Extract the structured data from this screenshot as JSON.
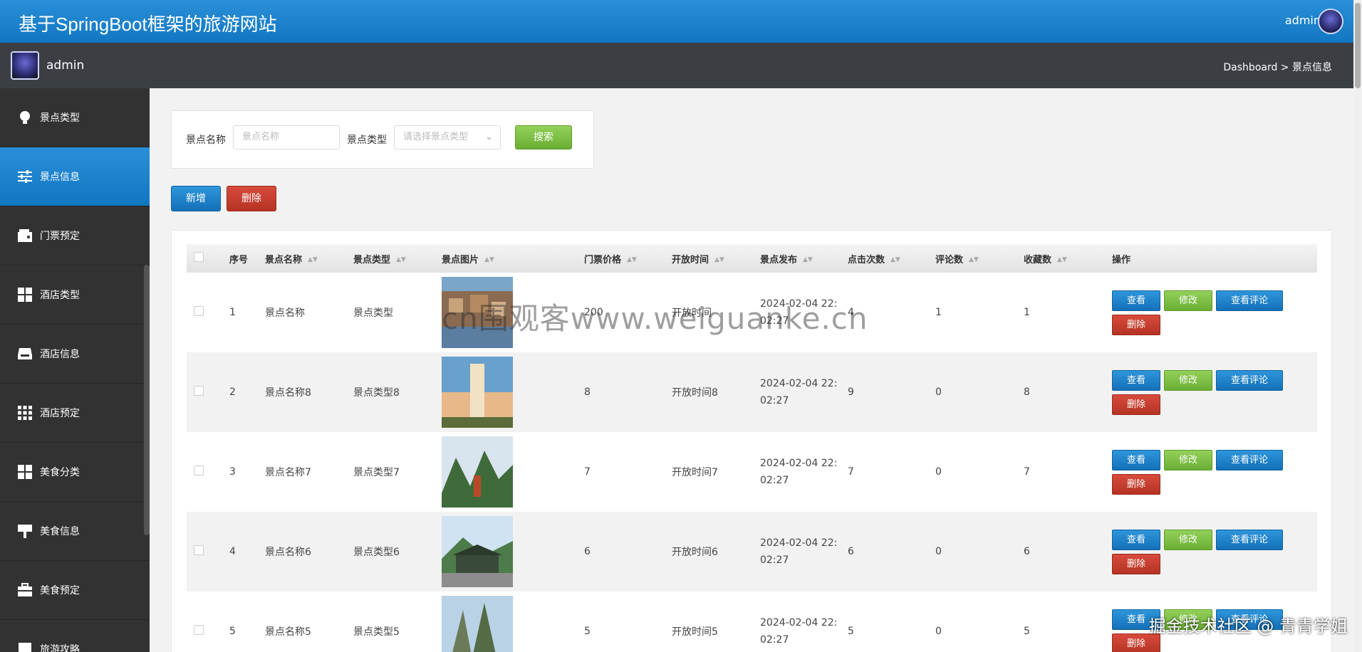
{
  "app": {
    "title": "基于SpringBoot框架的旅游网站",
    "user": "admin"
  },
  "subbar": {
    "user": "admin",
    "breadcrumb": "Dashboard > 景点信息"
  },
  "sidebar": {
    "items": [
      {
        "label": "景点类型",
        "icon": "lightbulb-icon"
      },
      {
        "label": "景点信息",
        "icon": "sliders-icon",
        "active": true
      },
      {
        "label": "门票预定",
        "icon": "wallet-icon"
      },
      {
        "label": "酒店类型",
        "icon": "grid-icon"
      },
      {
        "label": "酒店信息",
        "icon": "inbox-icon"
      },
      {
        "label": "酒店预定",
        "icon": "apps-icon"
      },
      {
        "label": "美食分类",
        "icon": "grid-icon"
      },
      {
        "label": "美食信息",
        "icon": "sign-icon"
      },
      {
        "label": "美食预定",
        "icon": "briefcase-icon"
      },
      {
        "label": "旅游攻略",
        "icon": "book-icon"
      }
    ]
  },
  "search": {
    "name_label": "景点名称",
    "name_placeholder": "景点名称",
    "type_label": "景点类型",
    "type_placeholder": "请选择景点类型",
    "search_button": "搜索"
  },
  "actions": {
    "add": "新增",
    "delete": "删除"
  },
  "table": {
    "headers": [
      "序号",
      "景点名称",
      "景点类型",
      "景点图片",
      "门票价格",
      "开放时间",
      "景点发布",
      "点击次数",
      "评论数",
      "收藏数",
      "操作"
    ],
    "row_buttons": {
      "view": "查看",
      "edit": "修改",
      "comments": "查看评论",
      "delete": "删除"
    },
    "rows": [
      {
        "no": "1",
        "name": "景点名称",
        "type": "景点类型",
        "price": "200",
        "open": "开放时间",
        "publish_1": "2024-02-04 22:",
        "publish_2": "02:27",
        "clicks": "4",
        "comments": "1",
        "favorites": "1",
        "img": "village"
      },
      {
        "no": "2",
        "name": "景点名称8",
        "type": "景点类型8",
        "price": "8",
        "open": "开放时间8",
        "publish_1": "2024-02-04 22:",
        "publish_2": "02:27",
        "clicks": "9",
        "comments": "0",
        "favorites": "8",
        "img": "tower"
      },
      {
        "no": "3",
        "name": "景点名称7",
        "type": "景点类型7",
        "price": "7",
        "open": "开放时间7",
        "publish_1": "2024-02-04 22:",
        "publish_2": "02:27",
        "clicks": "7",
        "comments": "0",
        "favorites": "7",
        "img": "karst"
      },
      {
        "no": "4",
        "name": "景点名称6",
        "type": "景点类型6",
        "price": "6",
        "open": "开放时间6",
        "publish_1": "2024-02-04 22:",
        "publish_2": "02:27",
        "clicks": "6",
        "comments": "0",
        "favorites": "6",
        "img": "temple"
      },
      {
        "no": "5",
        "name": "景点名称5",
        "type": "景点类型5",
        "price": "5",
        "open": "开放时间5",
        "publish_1": "2024-02-04 22:",
        "publish_2": "02:27",
        "clicks": "5",
        "comments": "0",
        "favorites": "5",
        "img": "peak"
      }
    ]
  },
  "overlay": {
    "watermark": "cn围观客www.weiguanke.cn",
    "credit": "掘金技术社区 @ 青青学姐"
  },
  "colors": {
    "primary": "#1a7fcb",
    "success": "#7cbf44",
    "danger": "#c23b2b",
    "sidebar": "#323232"
  }
}
